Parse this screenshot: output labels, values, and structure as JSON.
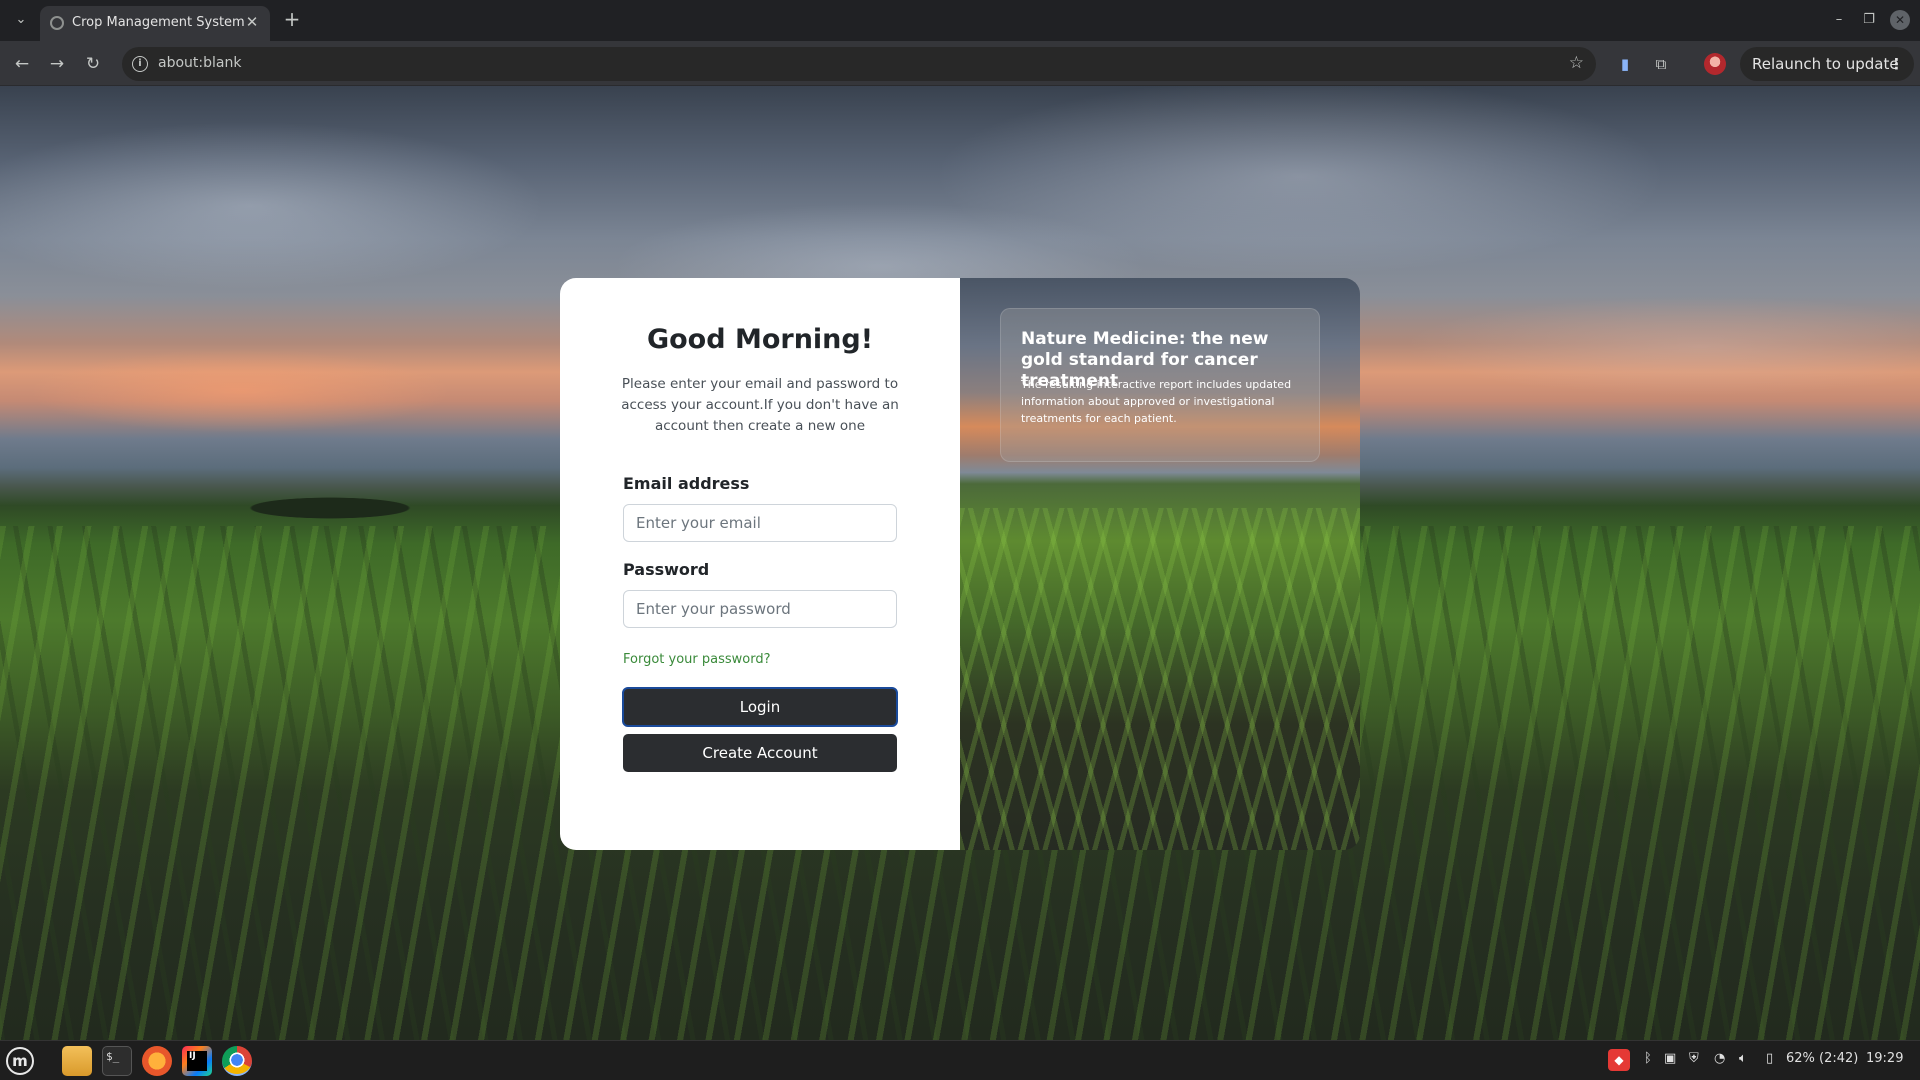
{
  "browser": {
    "tab_title": "Crop Management System",
    "tab_close": "✕",
    "new_tab": "+",
    "address": "about:blank",
    "relaunch_label": "Relaunch to update",
    "relaunch_menu": "⋮"
  },
  "login": {
    "greeting": "Good Morning!",
    "subtitle": "Please enter your email and password to access your account.If you don't have an account then create a new one",
    "email_label": "Email address",
    "email_placeholder": "Enter your email",
    "password_label": "Password",
    "password_placeholder": "Enter your password",
    "forgot_link": "Forgot your password?",
    "login_button": "Login",
    "create_button": "Create Account",
    "accent_color": "#3a8a3a",
    "button_color": "#2b2d30"
  },
  "promo": {
    "title": "Nature Medicine: the new gold standard for cancer treatment",
    "text": "The resulting interactive report includes updated information about approved or investigational treatments for each patient."
  },
  "taskbar": {
    "battery": "62% (2:42)",
    "clock": "19:29"
  },
  "icons": [
    "tab-list-icon",
    "favicon-icon",
    "close-icon",
    "minimize-icon",
    "maximize-icon",
    "back-icon",
    "forward-icon",
    "reload-icon",
    "info-icon",
    "star-icon",
    "extension-icon",
    "puzzle-icon",
    "profile-avatar",
    "mint-menu-icon",
    "files-icon",
    "terminal-icon",
    "firefox-icon",
    "intellij-icon",
    "chrome-icon",
    "wifi-icon",
    "volume-icon",
    "battery-icon"
  ]
}
